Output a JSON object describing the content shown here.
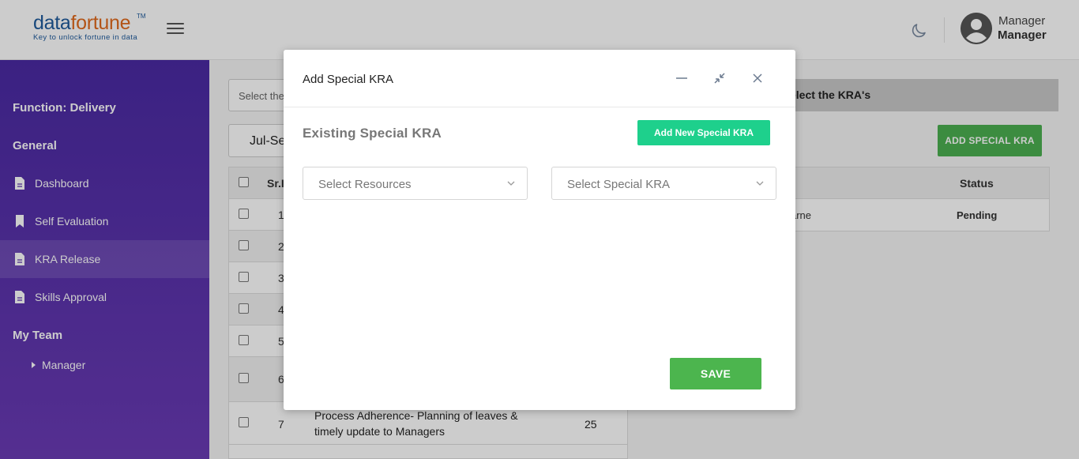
{
  "header": {
    "logo_data": "data",
    "logo_fortune": "fortune",
    "logo_tm": "TM",
    "logo_tagline": "Key to unlock fortune in data",
    "user_name": "Manager",
    "user_role": "Manager"
  },
  "sidebar": {
    "function_label": "Function: Delivery",
    "general_label": "General",
    "items": [
      {
        "label": "Dashboard"
      },
      {
        "label": "Self Evaluation"
      },
      {
        "label": "KRA Release"
      },
      {
        "label": "Skills Approval"
      }
    ],
    "my_team_label": "My Team",
    "sub_item": "Manager"
  },
  "main": {
    "select_placeholder": "Select the",
    "quarter": "Jul-Se",
    "kra_banner": "elect the KRA's",
    "add_special_button": "ADD SPECIAL KRA",
    "left_table": {
      "header_sr": "Sr.I",
      "rows": [
        {
          "sr": "1"
        },
        {
          "sr": "2"
        },
        {
          "sr": "3"
        },
        {
          "sr": "4"
        },
        {
          "sr": "5"
        },
        {
          "sr": "6"
        },
        {
          "sr": "7",
          "text": "Process Adherence- Planning of leaves & timely update to Managers",
          "value": "25"
        }
      ]
    },
    "right_table": {
      "status_header": "Status",
      "row_name": "arne",
      "row_status": "Pending"
    }
  },
  "modal": {
    "title": "Add Special KRA",
    "existing_title": "Existing Special KRA",
    "add_new_button": "Add New Special KRA",
    "resources_placeholder": "Select Resources",
    "special_kra_placeholder": "Select Special KRA",
    "save_button": "SAVE"
  },
  "colors": {
    "sidebar_top": "#4a2aa3",
    "sidebar_bottom": "#6a3bb5",
    "add_new_green": "#1ed08c",
    "save_green": "#4cb54e",
    "add_special_green": "#4caf50"
  }
}
